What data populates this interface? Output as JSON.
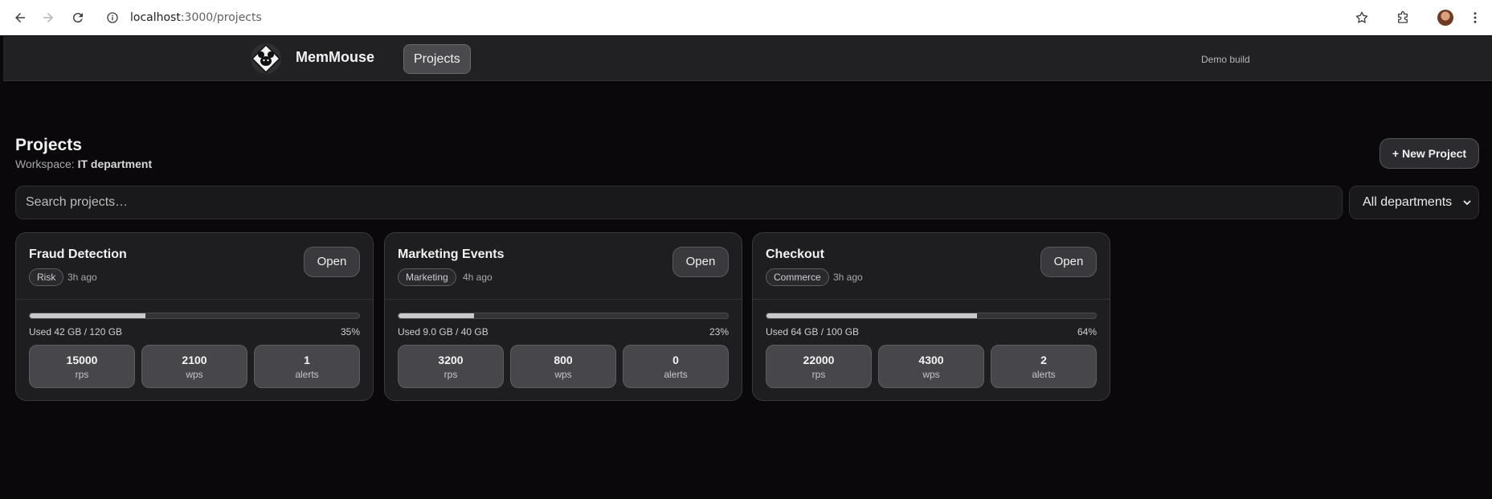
{
  "browser": {
    "url_host": "localhost",
    "url_path": ":3000/projects"
  },
  "header": {
    "brand": "MemMouse",
    "nav_projects": "Projects",
    "build_label": "Demo build"
  },
  "page": {
    "title": "Projects",
    "workspace_label": "Workspace:",
    "workspace_name": "IT department",
    "new_project_label": "+ New Project",
    "search_placeholder": "Search projects…",
    "department_filter": "All departments"
  },
  "projects": [
    {
      "name": "Fraud Detection",
      "tag": "Risk",
      "updated": "3h ago",
      "open_label": "Open",
      "usage_fraction": 0.35,
      "used_text": "Used 42 GB / 120 GB",
      "percent_text": "35%",
      "stats": [
        {
          "value": "15000",
          "label": "rps"
        },
        {
          "value": "2100",
          "label": "wps"
        },
        {
          "value": "1",
          "label": "alerts"
        }
      ]
    },
    {
      "name": "Marketing Events",
      "tag": "Marketing",
      "updated": "4h ago",
      "open_label": "Open",
      "usage_fraction": 0.23,
      "used_text": "Used 9.0 GB / 40 GB",
      "percent_text": "23%",
      "stats": [
        {
          "value": "3200",
          "label": "rps"
        },
        {
          "value": "800",
          "label": "wps"
        },
        {
          "value": "0",
          "label": "alerts"
        }
      ]
    },
    {
      "name": "Checkout",
      "tag": "Commerce",
      "updated": "3h ago",
      "open_label": "Open",
      "usage_fraction": 0.64,
      "used_text": "Used 64 GB / 100 GB",
      "percent_text": "64%",
      "stats": [
        {
          "value": "22000",
          "label": "rps"
        },
        {
          "value": "4300",
          "label": "wps"
        },
        {
          "value": "2",
          "label": "alerts"
        }
      ]
    }
  ],
  "icons": {
    "back": "arrow-left-icon",
    "forward": "arrow-right-icon",
    "reload": "reload-icon",
    "site_info": "info-icon",
    "bookmark": "star-icon",
    "extensions": "puzzle-icon",
    "menu": "more-vertical-icon",
    "logo": "mouse-logo-icon"
  },
  "colors": {
    "background": "#0a080b",
    "header": "#212023",
    "card": "#1e1d20",
    "bar_fill": "#c9c9c9"
  }
}
